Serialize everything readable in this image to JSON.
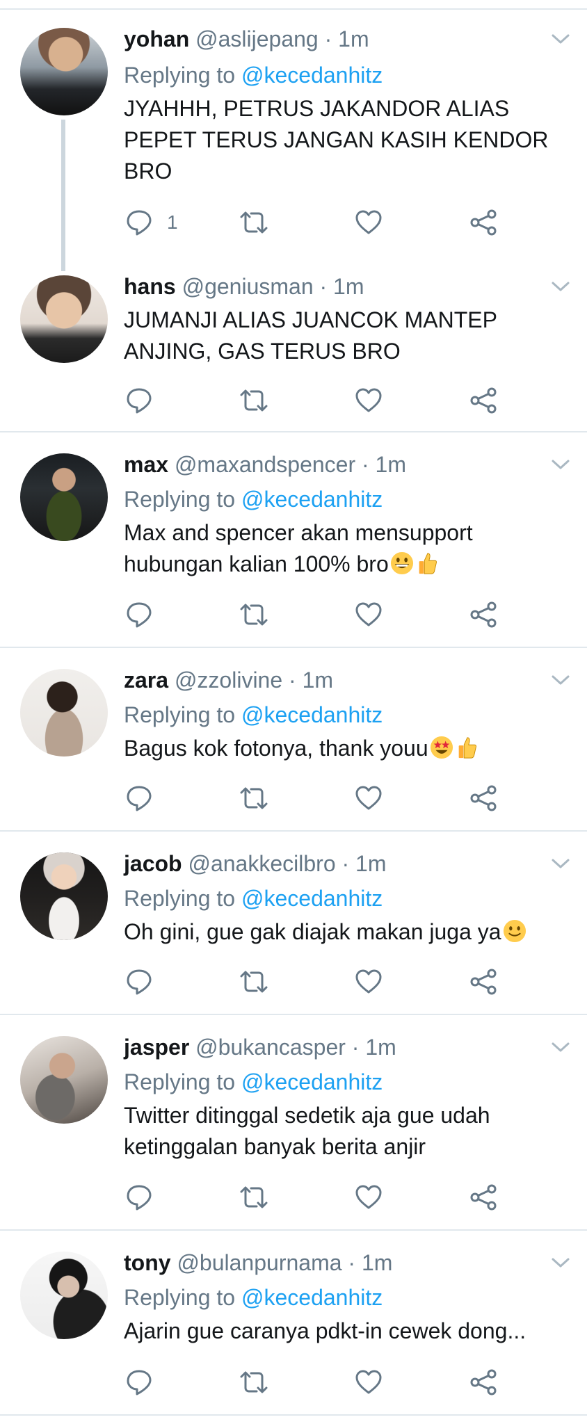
{
  "colors": {
    "text": "#14171a",
    "muted": "#657786",
    "link": "#1da1f2",
    "divider": "#e1e8ed",
    "thread_line": "#ccd6dd"
  },
  "icons": [
    "reply-icon",
    "retweet-icon",
    "like-icon",
    "share-icon",
    "chevron-down-icon"
  ],
  "tweets": [
    {
      "name": "yohan",
      "handle": "@aslijepang",
      "dot": "·",
      "time": "1m",
      "reply_prefix": "Replying to",
      "mention": "@kecedanhitz",
      "lines": [
        "JYAHHH, PETRUS JAKANDOR ALIAS",
        "PEPET TERUS JANGAN KASIH KENDOR",
        "BRO"
      ],
      "reply_count": "1"
    },
    {
      "name": "hans",
      "handle": "@geniusman",
      "dot": "·",
      "time": "1m",
      "lines": [
        "JUMANJI ALIAS JUANCOK MANTEP",
        "ANJING, GAS TERUS BRO"
      ]
    },
    {
      "name": "max",
      "handle": "@maxandspencer",
      "dot": "·",
      "time": "1m",
      "reply_prefix": "Replying to",
      "mention": "@kecedanhitz",
      "lines": [
        "Max and spencer akan mensupport",
        "hubungan kalian 100% bro"
      ],
      "emojis": [
        "grinning-face-emoji",
        "thumbs-up-emoji"
      ]
    },
    {
      "name": "zara",
      "handle": "@zzolivine",
      "dot": "·",
      "time": "1m",
      "reply_prefix": "Replying to",
      "mention": "@kecedanhitz",
      "lines": [
        "Bagus kok fotonya, thank youu"
      ],
      "emojis": [
        "star-struck-emoji",
        "thumbs-up-emoji"
      ]
    },
    {
      "name": "jacob",
      "handle": "@anakkecilbro",
      "dot": "·",
      "time": "1m",
      "reply_prefix": "Replying to",
      "mention": "@kecedanhitz",
      "lines": [
        "Oh gini, gue gak diajak makan juga ya"
      ],
      "emojis": [
        "slightly-smiling-face-emoji"
      ]
    },
    {
      "name": "jasper",
      "handle": "@bukancasper",
      "dot": "·",
      "time": "1m",
      "reply_prefix": "Replying to",
      "mention": "@kecedanhitz",
      "lines": [
        "Twitter ditinggal sedetik aja gue udah",
        "ketinggalan banyak berita anjir"
      ]
    },
    {
      "name": "tony",
      "handle": "@bulanpurnama",
      "dot": "·",
      "time": "1m",
      "reply_prefix": "Replying to",
      "mention": "@kecedanhitz",
      "lines": [
        "Ajarin gue caranya pdkt-in cewek dong..."
      ]
    }
  ]
}
